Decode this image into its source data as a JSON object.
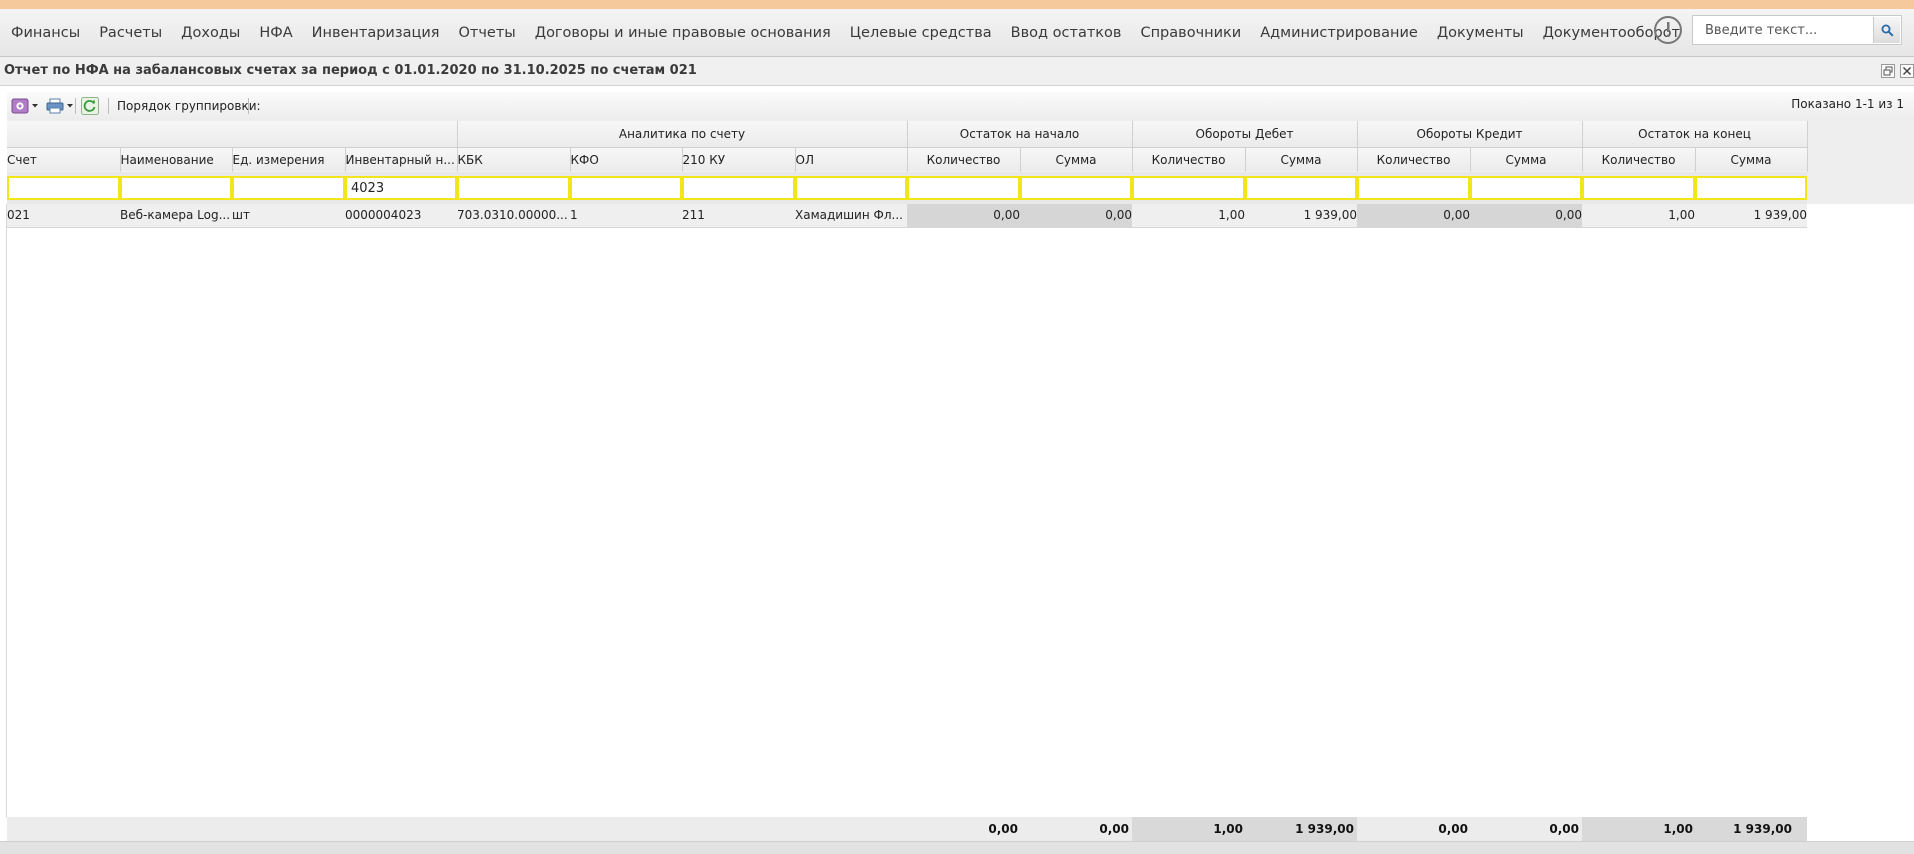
{
  "menu": {
    "items": [
      "Финансы",
      "Расчеты",
      "Доходы",
      "НФА",
      "Инвентаризация",
      "Отчеты",
      "Договоры и иные правовые основания",
      "Целевые средства",
      "Ввод остатков",
      "Справочники",
      "Администрирование",
      "Документы",
      "Документооборот"
    ],
    "search_placeholder": "Введите текст..."
  },
  "window": {
    "title": "Отчет по НФА на забалансовых счетах за период с 01.01.2020 по 31.10.2025 по счетам 021"
  },
  "toolbar": {
    "grouping_label": "Порядок группировки:",
    "shown": "Показано 1-1 из 1"
  },
  "grid": {
    "groups": {
      "analytics": "Аналитика по счету",
      "opening": "Остаток на начало",
      "debit": "Обороты Дебет",
      "credit": "Обороты Кредит",
      "closing": "Остаток на конец"
    },
    "columns": [
      "Счет",
      "Наименование",
      "Ед. измерения",
      "Инвентарный н...",
      "КБК",
      "КФО",
      "210 КУ",
      "ОЛ",
      "Количество",
      "Сумма",
      "Количество",
      "Сумма",
      "Количество",
      "Сумма",
      "Количество",
      "Сумма"
    ],
    "filters": [
      "",
      "",
      "",
      "4023",
      "",
      "",
      "",
      "",
      "",
      "",
      "",
      "",
      "",
      "",
      "",
      ""
    ],
    "rows": [
      [
        "021",
        "Веб-камера Log...",
        "шт",
        "0000004023",
        "703.0310.00000...",
        "1",
        "211",
        "Хамадишин Фл...",
        "0,00",
        "0,00",
        "1,00",
        "1 939,00",
        "0,00",
        "0,00",
        "1,00",
        "1 939,00"
      ]
    ],
    "totals": [
      "0,00",
      "0,00",
      "1,00",
      "1 939,00",
      "0,00",
      "0,00",
      "1,00",
      "1 939,00"
    ]
  },
  "colors": {
    "filter_border": "#f2e61a",
    "top_stripe": "#f5c99b"
  }
}
